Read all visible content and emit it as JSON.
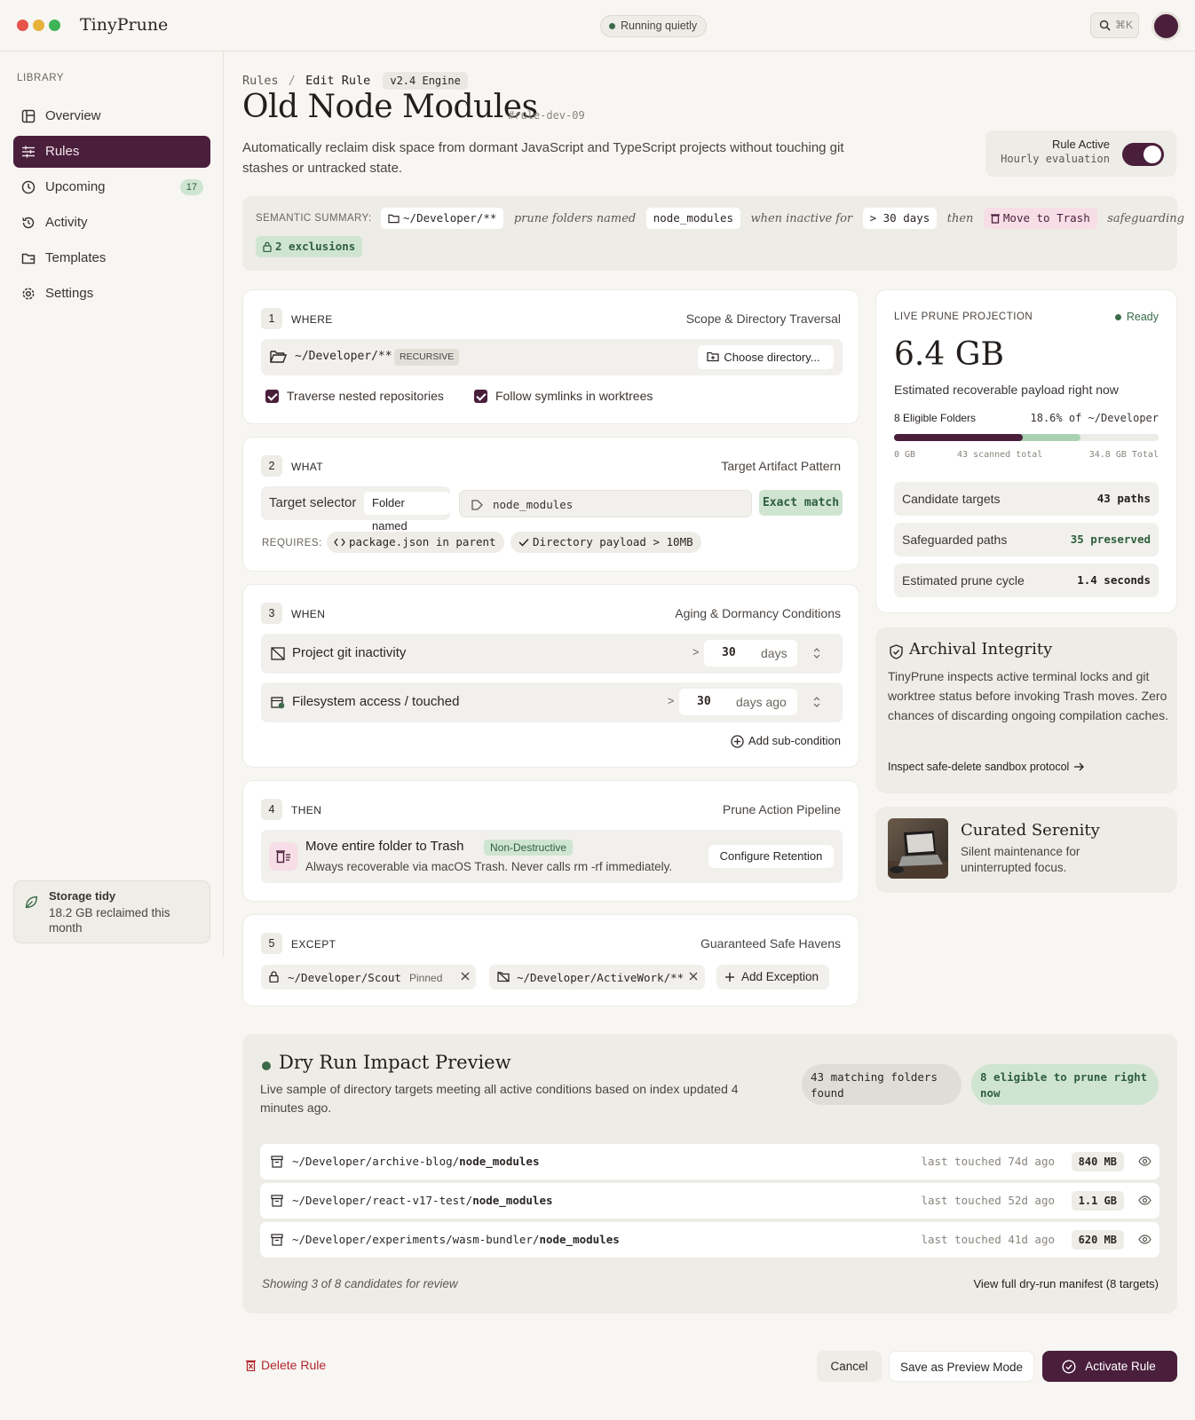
{
  "window": {
    "dots": [
      "#e5534b",
      "#e8b23a",
      "#3fb456"
    ]
  },
  "app": {
    "name": "TinyPrune",
    "status": "Running quietly",
    "search_shortcut": "⌘K"
  },
  "sidebar": {
    "section_label": "LIBRARY",
    "items": [
      {
        "label": "Overview",
        "icon": "layout-icon"
      },
      {
        "label": "Rules",
        "icon": "sliders-icon",
        "active": true
      },
      {
        "label": "Upcoming",
        "icon": "clock-icon",
        "badge": "17"
      },
      {
        "label": "Activity",
        "icon": "history-icon"
      },
      {
        "label": "Templates",
        "icon": "folder-template-icon"
      },
      {
        "label": "Settings",
        "icon": "gear-icon"
      }
    ],
    "storage": {
      "title": "Storage tidy",
      "detail": "18.2 GB reclaimed this month"
    }
  },
  "header": {
    "breadcrumb_root": "Rules",
    "breadcrumb_sep": "/",
    "breadcrumb_current": "Edit Rule",
    "engine": "v2.4 Engine",
    "title": "Old Node Modules",
    "rule_id": "#rule-dev-09",
    "description": "Automatically reclaim disk space from dormant JavaScript and TypeScript projects without touching git stashes or untracked state.",
    "rule_active_label": "Rule Active",
    "rule_active_sub": "Hourly evaluation",
    "rule_active": true
  },
  "summary": {
    "label": "SEMANTIC SUMMARY:",
    "path": "~/Developer/**",
    "t1": "prune folders named",
    "name": "node_modules",
    "t2": "when inactive for",
    "age": "> 30 days",
    "t3": "then",
    "action": "Move to Trash",
    "t4": "safeguarding",
    "exclusions": "2 exclusions"
  },
  "where": {
    "num": "1",
    "label": "WHERE",
    "right": "Scope & Directory Traversal",
    "path": "~/Developer/**",
    "recursive": "RECURSIVE",
    "choose": "Choose directory...",
    "opt1": "Traverse nested repositories",
    "opt2": "Follow symlinks in worktrees"
  },
  "what": {
    "num": "2",
    "label": "WHAT",
    "right": "Target Artifact Pattern",
    "selector_label": "Target selector",
    "selector_value": "Folder named",
    "pattern": "node_modules",
    "match": "Exact match",
    "requires_label": "REQUIRES:",
    "req1": "package.json in parent",
    "req2": "Directory payload > 10MB"
  },
  "when": {
    "num": "3",
    "label": "WHEN",
    "right": "Aging & Dormancy Conditions",
    "c1_label": "Project git inactivity",
    "c1_op": ">",
    "c1_value": "30",
    "c1_unit": "days",
    "c2_label": "Filesystem access / touched",
    "c2_op": ">",
    "c2_value": "30",
    "c2_unit": "days ago",
    "add": "Add sub-condition"
  },
  "then": {
    "num": "4",
    "label": "THEN",
    "right": "Prune Action Pipeline",
    "action": "Move entire folder to Trash",
    "tag": "Non-Destructive",
    "sub": "Always recoverable via macOS Trash. Never calls rm -rf immediately.",
    "configure": "Configure Retention"
  },
  "except": {
    "num": "5",
    "label": "EXCEPT",
    "right": "Guaranteed Safe Havens",
    "e1": "~/Developer/Scout",
    "e1_tag": "Pinned",
    "e2": "~/Developer/ActiveWork/**",
    "add": "Add Exception"
  },
  "projection": {
    "label": "LIVE PRUNE PROJECTION",
    "status": "Ready",
    "size": "6.4 GB",
    "size_caption": "Estimated recoverable payload right now",
    "eligible": "8 Eligible Folders",
    "percent": "18.6% of ~/Developer",
    "bar_primary": 0.486,
    "bar_secondary": 0.22,
    "scale_min": "0 GB",
    "scale_mid": "43 scanned total",
    "scale_max": "34.8 GB Total",
    "stats": [
      {
        "label": "Candidate targets",
        "value": "43 paths"
      },
      {
        "label": "Safeguarded paths",
        "value": "35 preserved"
      },
      {
        "label": "Estimated prune cycle",
        "value": "1.4 seconds"
      }
    ]
  },
  "integrity": {
    "title": "Archival Integrity",
    "body": "TinyPrune inspects active terminal locks and git worktree status before invoking Trash moves. Zero chances of discarding ongoing compilation caches.",
    "link": "Inspect safe-delete sandbox protocol"
  },
  "serenity": {
    "title": "Curated Serenity",
    "body": "Silent maintenance for uninterrupted focus."
  },
  "dryrun": {
    "title": "Dry Run Impact Preview",
    "body": "Live sample of directory targets meeting all active conditions based on index updated 4 minutes ago.",
    "found": "43 matching folders found",
    "eligible": "8 eligible to prune right now",
    "rows": [
      {
        "prefix": "~/Developer/archive-blog/",
        "target": "node_modules",
        "touched": "last touched 74d ago",
        "size": "840 MB"
      },
      {
        "prefix": "~/Developer/react-v17-test/",
        "target": "node_modules",
        "touched": "last touched 52d ago",
        "size": "1.1 GB"
      },
      {
        "prefix": "~/Developer/experiments/wasm-bundler/",
        "target": "node_modules",
        "touched": "last touched 41d ago",
        "size": "620 MB"
      }
    ],
    "showing": "Showing 3 of 8 candidates for review",
    "manifest": "View full dry-run manifest (8 targets)"
  },
  "footer": {
    "delete": "Delete Rule",
    "cancel": "Cancel",
    "preview": "Save as Preview Mode",
    "activate": "Activate Rule"
  },
  "colors": {
    "accent": "#4a1f3c",
    "success": "#cfe5d2",
    "danger": "#b3262d"
  }
}
